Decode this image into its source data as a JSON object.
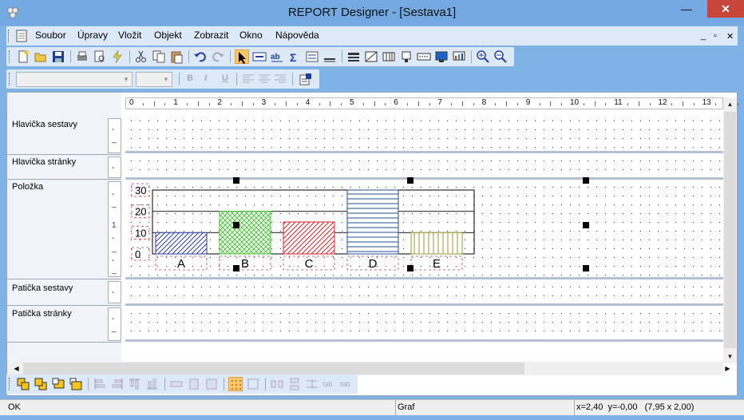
{
  "window": {
    "title": "REPORT Designer - [Sestava1]",
    "minimize": "—",
    "restore": "□",
    "close": "✕"
  },
  "menu": {
    "items": [
      "Soubor",
      "Úpravy",
      "Vložit",
      "Objekt",
      "Zobrazit",
      "Okno",
      "Nápověda"
    ],
    "mdi_min": "_",
    "mdi_restore": "▫",
    "mdi_close": "✕"
  },
  "format_toolbar": {
    "font_value": "",
    "size_value": "",
    "bold": "B",
    "italic": "I",
    "underline": "U"
  },
  "ruler": {
    "labels": [
      "0",
      "1",
      "2",
      "3",
      "4",
      "5",
      "6",
      "7",
      "8",
      "9",
      "10",
      "11",
      "12",
      "13"
    ]
  },
  "bands": [
    {
      "label": "Hlavička sestavy",
      "marks": [
        "-",
        "_"
      ]
    },
    {
      "label": "Hlavička stránky",
      "marks": [
        "-"
      ]
    },
    {
      "label": "Položka",
      "marks": [
        "-",
        "_",
        "1",
        "-",
        "_",
        "-",
        "_"
      ]
    },
    {
      "label": "Patička sestavy",
      "marks": [
        "-"
      ]
    },
    {
      "label": "Patička stránky",
      "marks": [
        "-",
        "_"
      ]
    }
  ],
  "chart_data": {
    "type": "bar",
    "categories": [
      "A",
      "B",
      "C",
      "D",
      "E"
    ],
    "values": [
      10,
      20,
      15,
      30,
      10
    ],
    "ylim": [
      0,
      30
    ],
    "yticks": [
      "30",
      "20",
      "10",
      "0"
    ],
    "fill_colors": [
      "#2b3d9e",
      "#4ec43c",
      "#d8242b",
      "#1f4f9b",
      "#9a9a30"
    ],
    "patterns": [
      "diagonal",
      "crosshatch",
      "diagonal",
      "horizontal",
      "vertical"
    ],
    "grid": true
  },
  "status": {
    "left": "OK",
    "middle": "Graf",
    "coords": "x=2,40  y=-0,00   (7,95 x 2,00)"
  },
  "colors": {
    "titlebar": "#73a9e0",
    "close": "#c7453a",
    "toolbar": "#dde9f7"
  }
}
